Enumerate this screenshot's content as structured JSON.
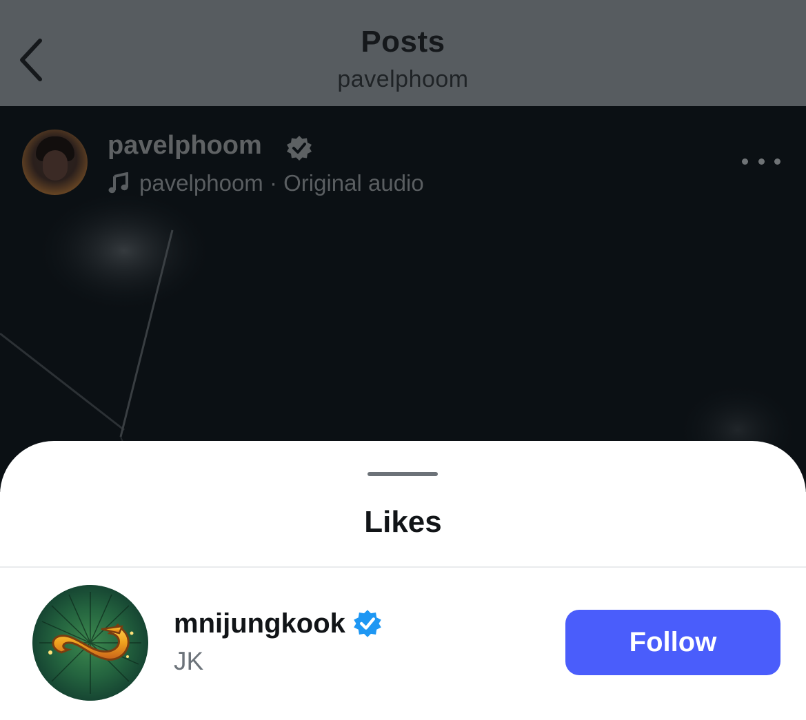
{
  "nav": {
    "title": "Posts",
    "subtitle": "pavelphoom",
    "back_icon": "chevron-left-icon"
  },
  "post": {
    "username": "pavelphoom",
    "verified_icon": "verified-badge-icon",
    "audio_icon": "music-note-icon",
    "audio_text": "pavelphoom · Original audio",
    "more_icon": "more-horizontal-icon"
  },
  "sheet": {
    "title": "Likes"
  },
  "likes": [
    {
      "username": "mnijungkook",
      "full_name": "JK",
      "verified": true,
      "button_label": "Follow"
    }
  ],
  "colors": {
    "follow_button": "#4a5dfb",
    "verified_badge": "#1e97f3",
    "dim_overlay": "#575c60"
  }
}
